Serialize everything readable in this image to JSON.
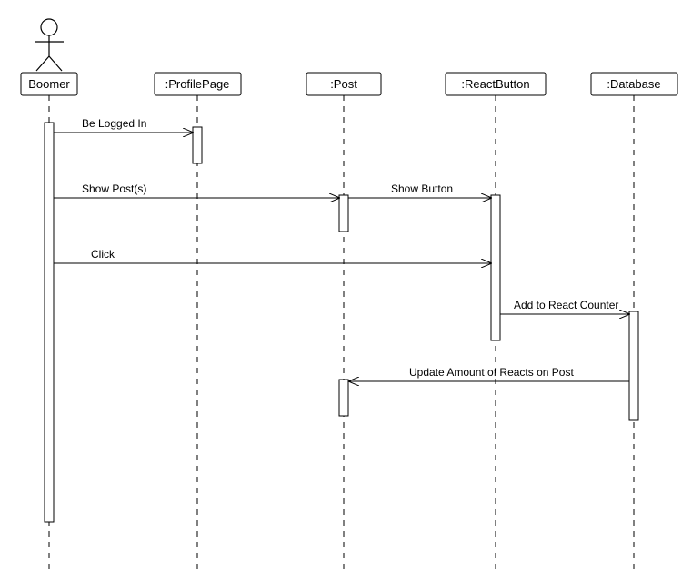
{
  "actor": {
    "name": "Boomer"
  },
  "participants": [
    {
      "name": ":ProfilePage"
    },
    {
      "name": ":Post"
    },
    {
      "name": ":ReactButton"
    },
    {
      "name": ":Database"
    }
  ],
  "messages": [
    {
      "label": "Be Logged In"
    },
    {
      "label": "Show Post(s)"
    },
    {
      "label": "Show Button"
    },
    {
      "label": "Click"
    },
    {
      "label": "Add to React Counter"
    },
    {
      "label": "Update Amount of Reacts on Post"
    }
  ]
}
